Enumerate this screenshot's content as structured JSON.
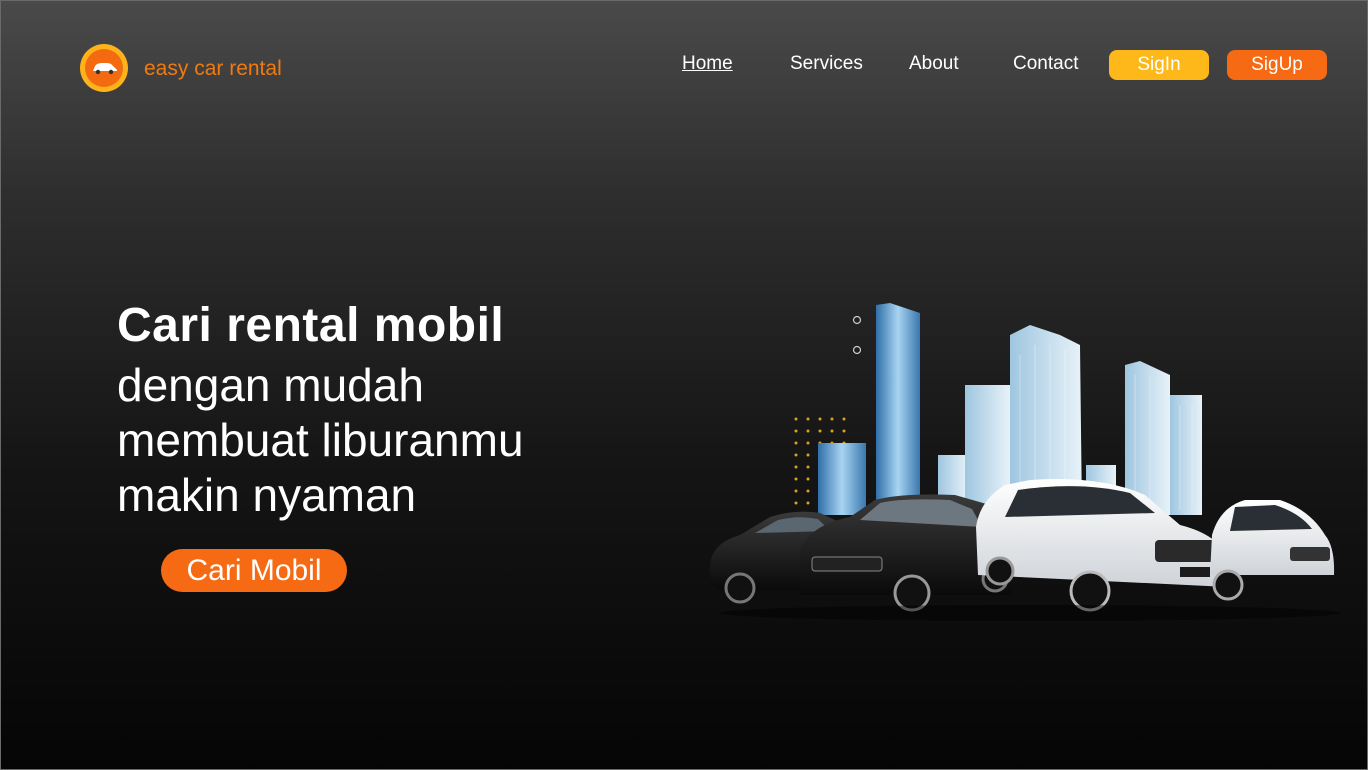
{
  "brand": {
    "name": "easy car rental"
  },
  "nav": {
    "items": [
      {
        "label": "Home",
        "active": true
      },
      {
        "label": "Services"
      },
      {
        "label": "About"
      },
      {
        "label": "Contact"
      }
    ],
    "signin_label": "SigIn",
    "signup_label": "SigUp"
  },
  "hero": {
    "title": "Cari rental mobil",
    "lines": [
      "dengan mudah",
      "membuat liburanmu",
      "makin nyaman"
    ],
    "cta_label": "Cari Mobil"
  },
  "colors": {
    "accent_orange": "#f56a12",
    "accent_yellow": "#ffb81a",
    "text": "#ffffff"
  },
  "icons": {
    "logo": "car-logo-icon",
    "illustration": "cars-city-illustration"
  }
}
